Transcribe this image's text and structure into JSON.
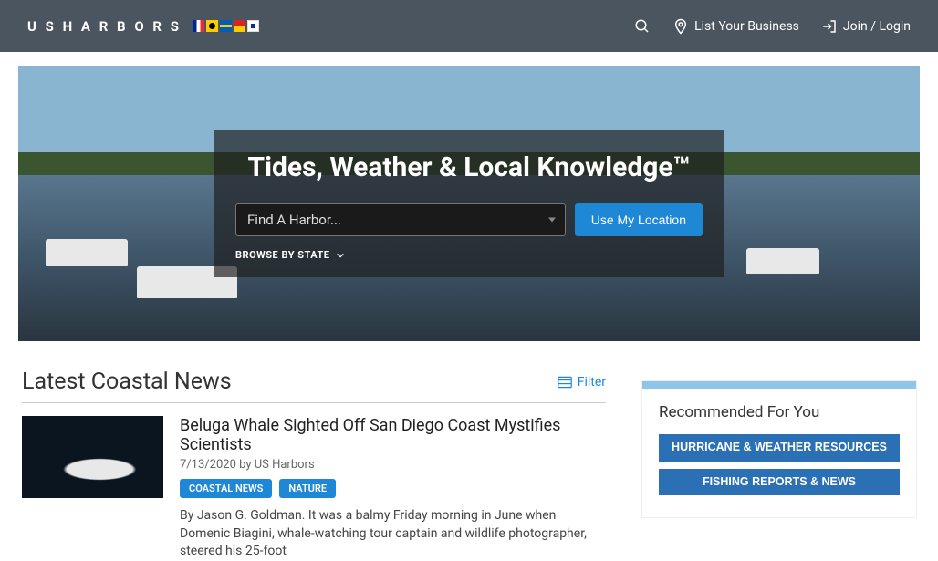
{
  "header": {
    "logo": "U S H A R B O R S",
    "links": {
      "list_business": "List Your Business",
      "join_login": "Join / Login"
    }
  },
  "hero": {
    "title": "Tides, Weather & Local Knowledge™",
    "select_placeholder": "Find A Harbor...",
    "location_btn": "Use My Location",
    "browse": "BROWSE BY STATE"
  },
  "news": {
    "heading": "Latest Coastal News",
    "filter": "Filter",
    "article": {
      "title": "Beluga Whale Sighted Off San Diego Coast Mystifies Scientists",
      "meta": "7/13/2020 by US Harbors",
      "tags": [
        "COASTAL NEWS",
        "NATURE"
      ],
      "excerpt": "By Jason G. Goldman. It was a balmy Friday morning in June when Domenic Biagini, whale-watching tour captain and wildlife photographer, steered his 25-foot"
    }
  },
  "sidebar": {
    "title": "Recommended For You",
    "buttons": [
      "HURRICANE & WEATHER RESOURCES",
      "FISHING REPORTS & NEWS"
    ]
  }
}
